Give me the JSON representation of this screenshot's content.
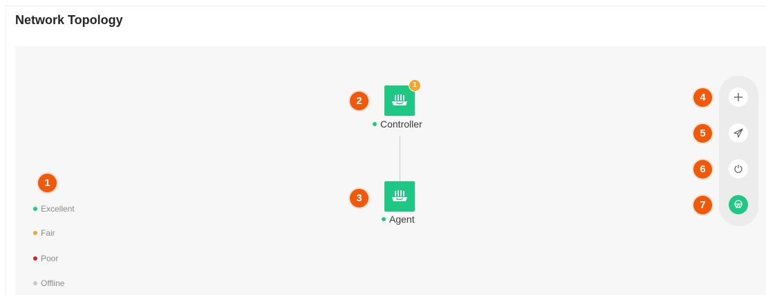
{
  "page": {
    "title": "Network Topology"
  },
  "nodes": {
    "controller": {
      "label": "Controller",
      "status": "excellent",
      "badge": "1"
    },
    "agent": {
      "label": "Agent",
      "status": "excellent"
    }
  },
  "legend": [
    {
      "label": "Excellent",
      "color": "#1ec783"
    },
    {
      "label": "Fair",
      "color": "#f2a72a"
    },
    {
      "label": "Poor",
      "color": "#e31b1b"
    },
    {
      "label": "Offline",
      "color": "#c8c8c8"
    }
  ],
  "callouts": [
    "1",
    "2",
    "3",
    "4",
    "5",
    "6",
    "7"
  ],
  "toolbar": {
    "buttons": [
      {
        "name": "add",
        "icon": "plus-icon"
      },
      {
        "name": "send",
        "icon": "paper-plane-icon"
      },
      {
        "name": "reboot",
        "icon": "power-icon"
      },
      {
        "name": "mesh",
        "icon": "network-icon",
        "active": true
      }
    ]
  },
  "colors": {
    "accent": "#1ec783",
    "callout": "#f0580a",
    "badge": "#f2a72a",
    "canvas_bg": "#f7f7f7"
  }
}
